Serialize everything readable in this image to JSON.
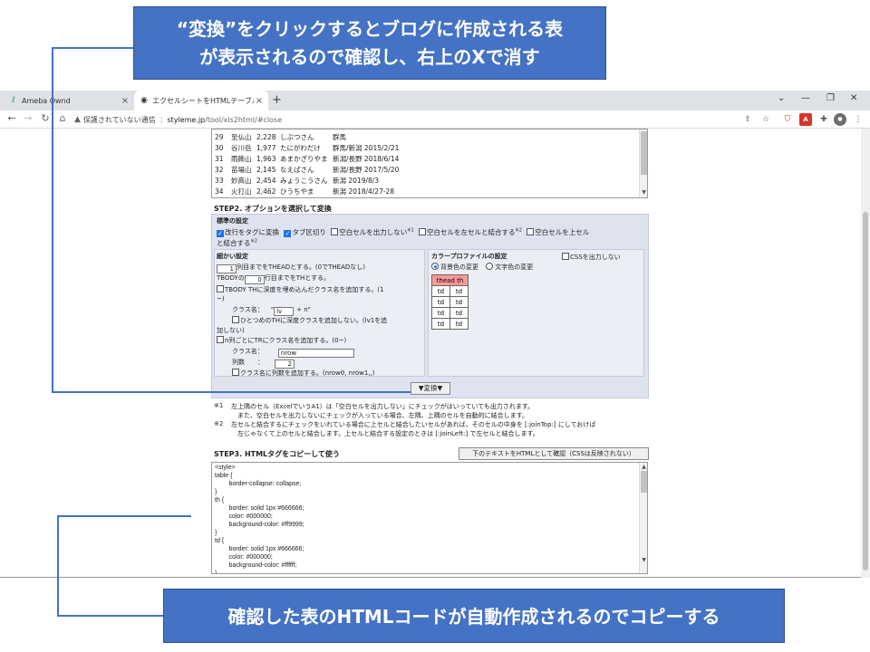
{
  "browser": {
    "tabs": [
      {
        "label": "Ameba Ownd",
        "active": false
      },
      {
        "label": "エクセルシートをHTMLテーブルに変換",
        "active": true
      }
    ],
    "new_tab": "+",
    "url_warning": "保護されていない通信",
    "url_host": "styleme.jp",
    "url_path": "/tool/xls2html/#close"
  },
  "step1": {
    "rows": [
      [
        "29",
        "至仏山",
        "2,228",
        "しぶつさん",
        "群馬"
      ],
      [
        "30",
        "谷川岳",
        "1,977",
        "たにがわだけ",
        "群馬/新潟 2015/2/21"
      ],
      [
        "31",
        "雨飾山",
        "1,963",
        "あまかざりやま",
        "新潟/長野 2018/6/14"
      ],
      [
        "32",
        "苗場山",
        "2,145",
        "なえばさん",
        "新潟/長野 2017/5/20"
      ],
      [
        "33",
        "妙高山",
        "2,454",
        "みょうこうさん",
        "新潟 2019/8/3"
      ],
      [
        "34",
        "火打山",
        "2,462",
        "ひうちやま",
        "新潟 2018/4/27-28"
      ]
    ]
  },
  "step2": {
    "title": "STEP2. オプションを選択して変換",
    "standard_heading": "標準の設定",
    "standard_options": {
      "newline_to_tag": "改行をタグに変換",
      "tab_delimited": "タブ区切り",
      "no_empty_cells": "空白セルを出力しない",
      "note1_mark": "※1",
      "merge_left": "空白セルを左セルと結合する",
      "note2_mark": "※2",
      "merge_up_1": "空白セルを上セル",
      "merge_up_2": "と結合する",
      "merge_up_mark": "※2"
    },
    "detail_heading": "細かい設定",
    "thead_rows": "1",
    "thead_label": "列目までをTHEADとする。(0でTHEADなし)",
    "tbody_prefix": "TBODYの",
    "tbody_th": "0",
    "tbody_label": "行目までをTHとする。",
    "depth_class_1": "TBODY THに深度を埋め込んだクラス名を追加する。(1",
    "depth_class_2": "~)",
    "class_name_label": "クラス名：",
    "class_name_prefix": "\"",
    "class_name_value": "lv",
    "class_name_suffix": "+ n\"",
    "first_th_1": "ひとつめのTHに深度クラスを追加しない。(lv1を追",
    "first_th_2": "加しない)",
    "nth_col_label": "n列ごとにTRにクラス名を追加する。(0~)",
    "class_name2_label": "クラス名：",
    "class_name2_value": "nrow",
    "col_count_label": "列数　　：",
    "col_count_value": "2",
    "add_col_count": "クラス名に列数を追加する。(nrow0, nrow1,,)",
    "color_heading": "カラープロファイルの設定",
    "css_output": "CSSを出力しない",
    "bg_color": "背景色の変更",
    "text_color": "文字色の変更",
    "preview_header": "thead th",
    "preview_cell": "td",
    "convert_button": "▼変換▼"
  },
  "notes": {
    "n1_mark": "※1",
    "n1_line1": "左上隅のセル（ExcelでいうA1）は「空白セルを出力しない」にチェックがはいっていても出力されます。",
    "n1_line2": "また、空白セルを出力しないにチェックが入っている場合、左隅、上隅のセルを自動的に結合します。",
    "n2_mark": "※2",
    "n2_line1": "左セルと結合するにチェックをいれている場合に上セルと結合したいセルがあれば、そのセルの中身を [:joinTop:] にしておけば",
    "n2_line2": "左じゃなくて上のセルと結合します。上セルと結合する設定のときは [:joinLeft:] で左セルと結合します。"
  },
  "step3": {
    "title": "STEP3. HTMLタグをコピーして使う",
    "confirm_button": "下のテキストをHTMLとして確認（CSSは反映されない）",
    "code_lines": [
      "<style>",
      "table {",
      "        border-collapse: collapse;",
      "}",
      "th {",
      "        border: solid 1px #666666;",
      "        color: #000000;",
      "        background-color: #ff9999;",
      "}",
      "td {",
      "        border: solid 1px #666666;",
      "        color: #000000;",
      "        background-color: #ffffff;",
      "}"
    ]
  },
  "callouts": {
    "top_line1": "“変換”をクリックするとブログに作成される表",
    "top_line2": "が表示されるので確認し、右上のXで消す",
    "bottom": "確認した表のHTMLコードが自動作成されるのでコピーする",
    "color": "#4472c4"
  },
  "colors": {
    "options_bg": "#dfe3ef",
    "preview_th_bg": "#ff9999"
  }
}
